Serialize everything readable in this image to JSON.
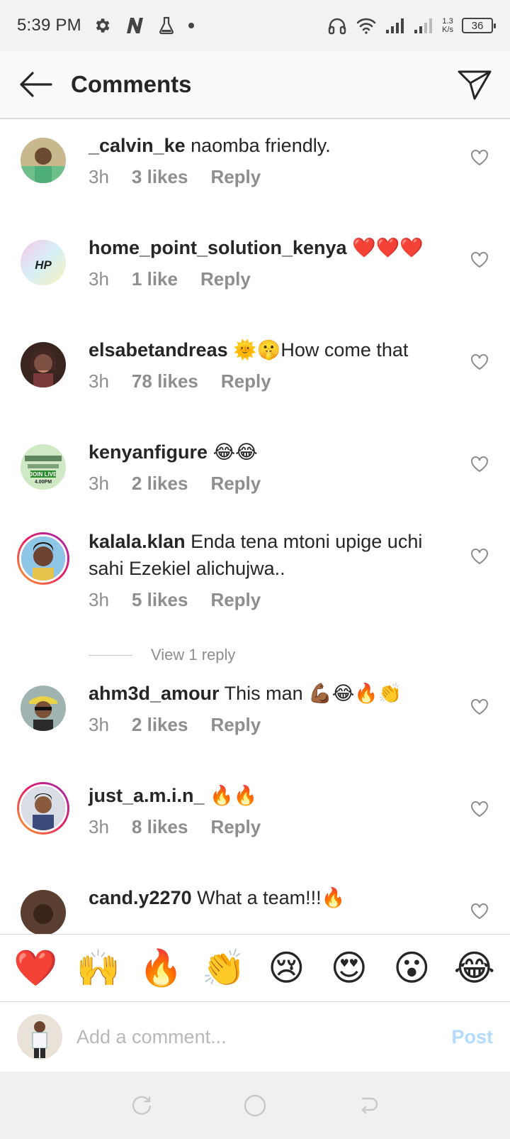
{
  "status_bar": {
    "time": "5:39 PM",
    "net_speed_value": "1.3",
    "net_speed_unit": "K/s",
    "battery": "36",
    "icons": [
      "gear-icon",
      "n-app-icon",
      "flask-icon",
      "dot-icon",
      "headphones-icon",
      "wifi-icon",
      "signal-icon",
      "signal-icon-2"
    ]
  },
  "header": {
    "title": "Comments",
    "back_icon": "back-arrow-icon",
    "share_icon": "send-icon"
  },
  "comments": [
    {
      "username": "_calvin_ke",
      "text": " naomba friendly.",
      "time": "3h",
      "likes": "3 likes",
      "reply": "Reply"
    },
    {
      "username": "home_point_solution_kenya",
      "text": " ❤️❤️❤️",
      "time": "3h",
      "likes": "1 like",
      "reply": "Reply",
      "avatar_text": "HP"
    },
    {
      "username": "elsabetandreas",
      "text": " 🌞🤫How come that",
      "time": "3h",
      "likes": "78 likes",
      "reply": "Reply"
    },
    {
      "username": "kenyanfigure",
      "text": " 😂😂",
      "time": "3h",
      "likes": "2 likes",
      "reply": "Reply",
      "avatar_text_1": "JOIN LIVE",
      "avatar_text_2": "4.00PM"
    },
    {
      "username": "kalala.klan",
      "text": " Enda tena mtoni upige uchi sahi Ezekiel alichujwa..",
      "time": "3h",
      "likes": "5 likes",
      "reply": "Reply"
    },
    {
      "username": "ahm3d_amour",
      "text": " This man 💪🏾😂🔥👏",
      "time": "3h",
      "likes": "2 likes",
      "reply": "Reply"
    },
    {
      "username": "just_a.m.i.n_",
      "text": " 🔥🔥",
      "time": "3h",
      "likes": "8 likes",
      "reply": "Reply"
    },
    {
      "username": "cand.y2270",
      "text": " What a team!!!🔥"
    }
  ],
  "view_replies": "View 1 reply",
  "emoji_bar": [
    "❤️",
    "🙌",
    "🔥",
    "👏",
    "😢",
    "😍",
    "😮",
    "😂"
  ],
  "input": {
    "placeholder": "Add a comment...",
    "post_label": "Post"
  },
  "colors": {
    "text": "#262626",
    "secondary": "#8e8e8e",
    "post_disabled": "#b3dbff"
  }
}
